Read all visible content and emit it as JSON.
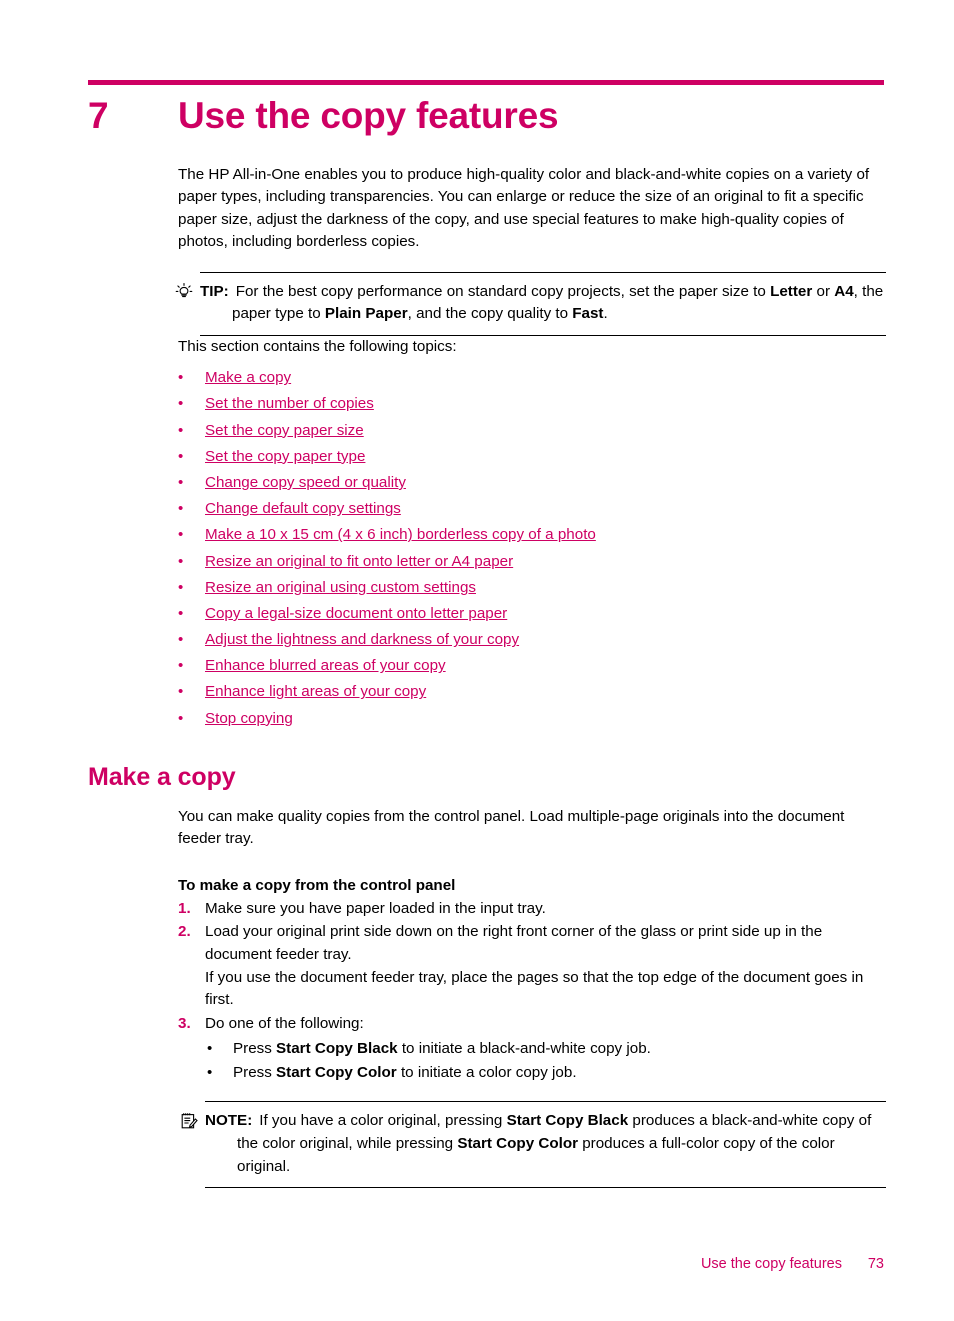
{
  "chapter": {
    "number": "7",
    "title": "Use the copy features",
    "accent_color": "#CE0063"
  },
  "intro": {
    "paragraph": "The HP All-in-One enables you to produce high-quality color and black-and-white copies on a variety of paper types, including transparencies. You can enlarge or reduce the size of an original to fit a specific paper size, adjust the darkness of the copy, and use special features to make high-quality copies of photos, including borderless copies."
  },
  "tip": {
    "icon": "lightbulb-icon",
    "label": "TIP:",
    "text_part1": "For the best copy performance on standard copy projects, set the paper size to ",
    "bold1": "Letter",
    "text_part2": " or ",
    "bold2": "A4",
    "text_part3": ", the paper type to ",
    "bold3": "Plain Paper",
    "text_part4": ", and the copy quality to ",
    "bold4": "Fast",
    "text_part5": "."
  },
  "topics": {
    "lead_in": "This section contains the following topics:",
    "bullet_glyph": "•",
    "items": [
      {
        "label": "Make a copy"
      },
      {
        "label": "Set the number of copies"
      },
      {
        "label": "Set the copy paper size"
      },
      {
        "label": "Set the copy paper type"
      },
      {
        "label": "Change copy speed or quality"
      },
      {
        "label": "Change default copy settings"
      },
      {
        "label": "Make a 10 x 15 cm (4 x 6 inch) borderless copy of a photo"
      },
      {
        "label": "Resize an original to fit onto letter or A4 paper"
      },
      {
        "label": "Resize an original using custom settings"
      },
      {
        "label": "Copy a legal-size document onto letter paper"
      },
      {
        "label": "Adjust the lightness and darkness of your copy"
      },
      {
        "label": "Enhance blurred areas of your copy"
      },
      {
        "label": "Enhance light areas of your copy"
      },
      {
        "label": "Stop copying"
      }
    ]
  },
  "section": {
    "heading": "Make a copy",
    "paragraph": "You can make quality copies from the control panel. Load multiple-page originals into the document feeder tray.",
    "procedure_title": "To make a copy from the control panel",
    "steps": [
      {
        "number": "1.",
        "text": "Make sure you have paper loaded in the input tray."
      },
      {
        "number": "2.",
        "text": "Load your original print side down on the right front corner of the glass or print side up in the document feeder tray.",
        "extra": "If you use the document feeder tray, place the pages so that the top edge of the document goes in first."
      },
      {
        "number": "3.",
        "text": "Do one of the following:"
      }
    ],
    "substeps": {
      "bullet_glyph": "•",
      "items": [
        {
          "prefix": "Press ",
          "bold": "Start Copy Black",
          "suffix": " to initiate a black-and-white copy job."
        },
        {
          "prefix": "Press ",
          "bold": "Start Copy Color",
          "suffix": " to initiate a color copy job."
        }
      ]
    }
  },
  "note": {
    "icon": "notepad-pencil-icon",
    "label": "NOTE:",
    "text_part1": "If you have a color original, pressing ",
    "bold1": "Start Copy Black",
    "text_part2": " produces a black-and-white copy of the color original, while pressing ",
    "bold2": "Start Copy Color",
    "text_part3": " produces a full-color copy of the color original."
  },
  "footer": {
    "title": "Use the copy features",
    "page_number": "73"
  }
}
